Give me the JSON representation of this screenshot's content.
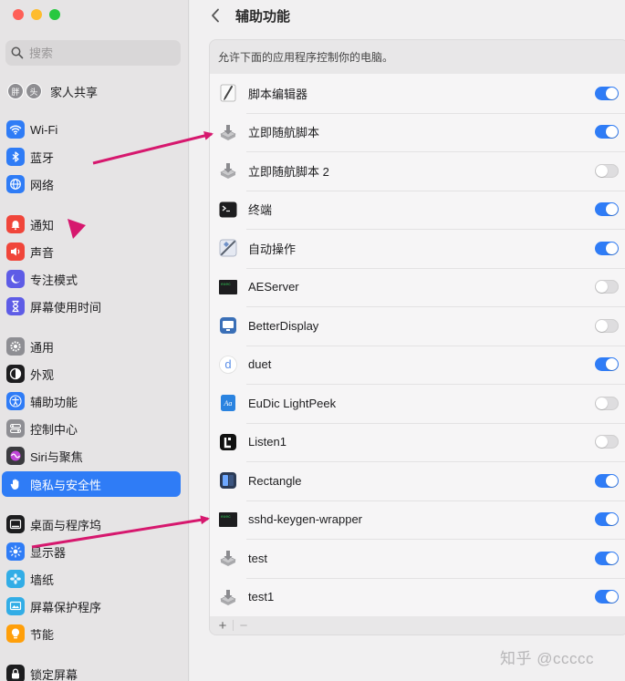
{
  "sidebar": {
    "search_placeholder": "搜索",
    "family": {
      "label": "家人共享",
      "avatars": [
        "胖",
        "头"
      ]
    },
    "items": [
      {
        "label": "Wi-Fi",
        "icon": "wifi-icon",
        "color": "#2f7cf6"
      },
      {
        "label": "蓝牙",
        "icon": "bluetooth-icon",
        "color": "#2f7cf6"
      },
      {
        "label": "网络",
        "icon": "globe-icon",
        "color": "#2f7cf6"
      },
      {
        "label": "通知",
        "icon": "bell-icon",
        "color": "#f0453a"
      },
      {
        "label": "声音",
        "icon": "speaker-icon",
        "color": "#f0453a"
      },
      {
        "label": "专注模式",
        "icon": "moon-icon",
        "color": "#5e5ce6"
      },
      {
        "label": "屏幕使用时间",
        "icon": "hourglass-icon",
        "color": "#5e5ce6"
      },
      {
        "label": "通用",
        "icon": "gear-icon",
        "color": "#8e8e93"
      },
      {
        "label": "外观",
        "icon": "appearance-icon",
        "color": "#1d1d1f"
      },
      {
        "label": "辅助功能",
        "icon": "accessibility-icon",
        "color": "#2f7cf6"
      },
      {
        "label": "控制中心",
        "icon": "control-center-icon",
        "color": "#8e8e93"
      },
      {
        "label": "Siri与聚焦",
        "icon": "siri-icon",
        "color": "#3b3b3f"
      },
      {
        "label": "隐私与安全性",
        "icon": "hand-icon",
        "color": "#2f7cf6",
        "active": true
      },
      {
        "label": "桌面与程序坞",
        "icon": "dock-icon",
        "color": "#1d1d1f"
      },
      {
        "label": "显示器",
        "icon": "sun-icon",
        "color": "#2f7cf6"
      },
      {
        "label": "墙纸",
        "icon": "flower-icon",
        "color": "#32ade6"
      },
      {
        "label": "屏幕保护程序",
        "icon": "screensaver-icon",
        "color": "#32ade6"
      },
      {
        "label": "节能",
        "icon": "bulb-icon",
        "color": "#ff9f0a"
      },
      {
        "label": "锁定屏幕",
        "icon": "lock-icon",
        "color": "#1d1d1f"
      }
    ]
  },
  "header": {
    "title": "辅助功能",
    "back_icon": "chevron-left-icon"
  },
  "panel": {
    "description": "允许下面的应用程序控制你的电脑。",
    "apps": [
      {
        "name": "脚本编辑器",
        "icon": "script-editor-icon",
        "enabled": true
      },
      {
        "name": "立即随航脚本",
        "icon": "installer-icon",
        "enabled": true
      },
      {
        "name": "立即随航脚本 2",
        "icon": "installer-icon",
        "enabled": false
      },
      {
        "name": "终端",
        "icon": "terminal-icon",
        "enabled": true
      },
      {
        "name": "自动操作",
        "icon": "automator-icon",
        "enabled": true
      },
      {
        "name": "AEServer",
        "icon": "terminal-exec-icon",
        "enabled": false
      },
      {
        "name": "BetterDisplay",
        "icon": "betterdisplay-icon",
        "enabled": false
      },
      {
        "name": "duet",
        "icon": "duet-icon",
        "enabled": true
      },
      {
        "name": "EuDic LightPeek",
        "icon": "eudic-icon",
        "enabled": false
      },
      {
        "name": "Listen1",
        "icon": "listen1-icon",
        "enabled": false
      },
      {
        "name": "Rectangle",
        "icon": "rectangle-icon",
        "enabled": true
      },
      {
        "name": "sshd-keygen-wrapper",
        "icon": "terminal-exec-icon",
        "enabled": true
      },
      {
        "name": "test",
        "icon": "installer-icon",
        "enabled": true
      },
      {
        "name": "test1",
        "icon": "installer-icon",
        "enabled": true
      }
    ],
    "footer": {
      "add_label": "+",
      "remove_label": "−"
    }
  },
  "watermark": "知乎 @ccccc",
  "colors": {
    "accent": "#2f7cf6",
    "annotation": "#d6186e"
  }
}
